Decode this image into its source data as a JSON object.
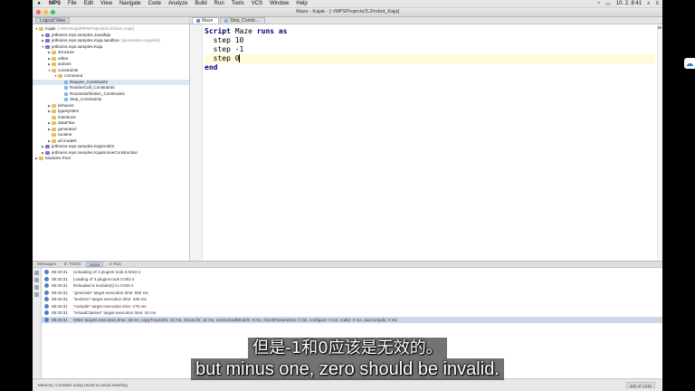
{
  "menubar": {
    "app_name": "MPS",
    "items": [
      "File",
      "Edit",
      "View",
      "Navigate",
      "Code",
      "Analyze",
      "Build",
      "Run",
      "Tools",
      "VCS",
      "Window",
      "Help"
    ],
    "clock": "10. 2. 8:41"
  },
  "window": {
    "title": "Maze - Kajak - [~/MPSProjects/3.2/robot_Kaja]"
  },
  "project_panel": {
    "tab": "Logical View",
    "tree": [
      {
        "label": "Kajak",
        "note": "(~/Dev/Kaja/MPSProjects/3.2/robot_Kaja)",
        "indent": 0,
        "arrow": "▼",
        "icon": "folder"
      },
      {
        "label": "jetbrains.mps.samples.Javaifaja",
        "note": "",
        "indent": 1,
        "arrow": "▶",
        "icon": "module"
      },
      {
        "label": "jetbrains.mps.samples.Kaja.sandbox",
        "note": "(generation required)",
        "indent": 1,
        "arrow": "▶",
        "icon": "module"
      },
      {
        "label": "jetbrains.mps.samples.Kaja",
        "note": "",
        "indent": 1,
        "arrow": "▼",
        "icon": "module"
      },
      {
        "label": "structure",
        "note": "",
        "indent": 2,
        "arrow": "▶",
        "icon": "folder"
      },
      {
        "label": "editor",
        "note": "",
        "indent": 2,
        "arrow": "▶",
        "icon": "folder"
      },
      {
        "label": "actions",
        "note": "",
        "indent": 2,
        "arrow": "▶",
        "icon": "folder"
      },
      {
        "label": "constraints",
        "note": "",
        "indent": 2,
        "arrow": "▼",
        "icon": "folder"
      },
      {
        "label": "command",
        "note": "",
        "indent": 3,
        "arrow": "▼",
        "icon": "folder"
      },
      {
        "label": "Require_Constraints",
        "note": "",
        "indent": 4,
        "arrow": "",
        "icon": "leaf",
        "selected": true
      },
      {
        "label": "RoutineCall_Constraints",
        "note": "",
        "indent": 4,
        "arrow": "",
        "icon": "leaf"
      },
      {
        "label": "RoutineDefinition_Constraints",
        "note": "",
        "indent": 4,
        "arrow": "",
        "icon": "leaf"
      },
      {
        "label": "Step_Constraints",
        "note": "",
        "indent": 4,
        "arrow": "",
        "icon": "leaf"
      },
      {
        "label": "behavior",
        "note": "",
        "indent": 2,
        "arrow": "▶",
        "icon": "folder"
      },
      {
        "label": "typesystem",
        "note": "",
        "indent": 2,
        "arrow": "▶",
        "icon": "folder"
      },
      {
        "label": "intentions",
        "note": "",
        "indent": 2,
        "arrow": "",
        "icon": "folder"
      },
      {
        "label": "dataFlow",
        "note": "",
        "indent": 2,
        "arrow": "▶",
        "icon": "folder"
      },
      {
        "label": "generator/",
        "note": "",
        "indent": 2,
        "arrow": "▶",
        "icon": "folder"
      },
      {
        "label": "runtime",
        "note": "",
        "indent": 2,
        "arrow": "",
        "icon": "folder"
      },
      {
        "label": "all models",
        "note": "",
        "indent": 2,
        "arrow": "▶",
        "icon": "folder"
      },
      {
        "label": "jetbrains.mps.samples.KajaAndOr",
        "note": "",
        "indent": 1,
        "arrow": "▶",
        "icon": "module"
      },
      {
        "label": "jetbrains.mps.samples.KajaSceneConstruction",
        "note": "",
        "indent": 1,
        "arrow": "▶",
        "icon": "module"
      },
      {
        "label": "Modules Pool",
        "note": "",
        "indent": 0,
        "arrow": "▶",
        "icon": "folder"
      }
    ]
  },
  "editor": {
    "tabs": [
      {
        "label": "Maze",
        "active": true
      },
      {
        "label": "Step_Constr...",
        "active": false
      }
    ],
    "lines": [
      {
        "kw": "Script",
        "rest": " Maze ",
        "kw2": "runs as"
      },
      {
        "kw": "",
        "rest": "  step 10",
        "kw2": ""
      },
      {
        "kw": "",
        "rest": "  step -1",
        "kw2": ""
      },
      {
        "kw": "",
        "rest": "  step 0",
        "kw2": ""
      },
      {
        "kw": "end",
        "rest": "",
        "kw2": ""
      }
    ]
  },
  "messages_panel": {
    "tabs": [
      {
        "label": "Messages",
        "active": false
      },
      {
        "label": "6: TODO",
        "active": false
      },
      {
        "label": "Make",
        "active": true
      },
      {
        "label": "4: Run",
        "active": false
      }
    ],
    "lines": [
      {
        "time": "08:40:31",
        "text": "Unloading of 3 plugins took 0.0010 s"
      },
      {
        "time": "08:40:31",
        "text": "Loading of 3 plugins took 0.002 s"
      },
      {
        "time": "08:40:31",
        "text": "Reloaded 6 module(s) in 0.034 s"
      },
      {
        "time": "08:40:31",
        "text": "\"generate\" target execution time: 694 ms"
      },
      {
        "time": "08:40:31",
        "text": "\"textGen\" target execution time: 230 ms"
      },
      {
        "time": "08:40:31",
        "text": "\"compile\" target execution time: 176 ms"
      },
      {
        "time": "08:40:31",
        "text": "\"reloadClasses\" target execution time: 34 ms"
      },
      {
        "time": "08:40:31",
        "text": "Other targets execution time: 38 ms; copyTraceInfo: 23 ms, reconcile: 16 ms, unresolvedModels: 0 ms, checkParameters: 0 ms, configure: 0 ms, make: 0 ms, auxCompile: 0 ms"
      }
    ]
  },
  "statusbar": {
    "text": "Memory: Consider using revert to avoid rewriting",
    "position": "420 of 1419"
  },
  "subtitles": {
    "chinese": "但是-1和0应该是无效的。",
    "english": "but minus one, zero should be invalid."
  },
  "colors": {
    "keyword": "#000080",
    "current_line": "#fffbd8",
    "selection": "#dde6f3"
  }
}
